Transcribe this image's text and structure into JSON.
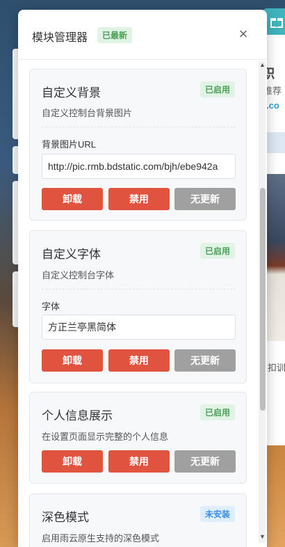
{
  "background": {
    "right_heading": "职",
    "right_sub": "推荐",
    "right_link": ".co",
    "right_text2": "扣训"
  },
  "gift_icon": "gift-icon",
  "modal": {
    "title": "模块管理器",
    "badge": "已最新",
    "close_icon": "×",
    "modules": [
      {
        "title": "自定义背景",
        "status": "已启用",
        "description": "自定义控制台背景图片",
        "field_label": "背景图片URL",
        "field_value": "http://pic.rmb.bdstatic.com/bjh/ebe942a",
        "buttons": [
          "卸载",
          "禁用",
          "无更新"
        ]
      },
      {
        "title": "自定义字体",
        "status": "已启用",
        "description": "自定义控制台字体",
        "field_label": "字体",
        "field_value": "方正兰亭黑简体",
        "buttons": [
          "卸载",
          "禁用",
          "无更新"
        ]
      },
      {
        "title": "个人信息展示",
        "status": "已启用",
        "description": "在设置页面显示完整的个人信息",
        "buttons": [
          "卸载",
          "禁用",
          "无更新"
        ]
      },
      {
        "title": "深色模式",
        "status": "未安装",
        "description": "启用雨云原生支持的深色模式"
      }
    ]
  },
  "colors": {
    "danger": "#e0533e",
    "disabled": "#a0a0a0",
    "enabled_badge": "#4ca15a",
    "not_installed_badge": "#3a8fe3"
  }
}
